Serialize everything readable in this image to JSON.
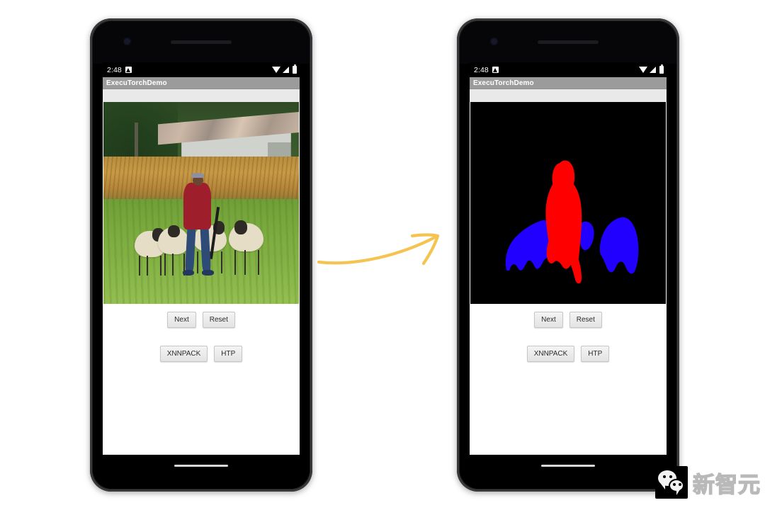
{
  "page": {
    "background_color": "#ffffff",
    "description": "ExecuTorchDemo Android app before and after semantic segmentation"
  },
  "arrow": {
    "name": "curved-arrow",
    "color": "#f5c34f"
  },
  "watermark": {
    "text": "新智元",
    "logo_name": "wechat-logo",
    "logo_bg": "#000000"
  },
  "phones": [
    {
      "id": "left",
      "statusbar": {
        "time": "2:48",
        "notification_icon": "notification-icon",
        "wifi_icon": "wifi-icon",
        "signal_icon": "cellular-signal-icon",
        "battery_icon": "battery-icon"
      },
      "appbar": {
        "title": "ExecuTorchDemo"
      },
      "image": {
        "kind": "photo",
        "alt": "Shepherd in red jacket with four sheep in a green field, barn and dry grass behind"
      },
      "controls": {
        "row1": [
          {
            "label": "Next"
          },
          {
            "label": "Reset"
          }
        ],
        "row2": [
          {
            "label": "XNNPACK"
          },
          {
            "label": "HTP"
          }
        ]
      },
      "navbar": {
        "home_indicator": "home-indicator"
      }
    },
    {
      "id": "right",
      "statusbar": {
        "time": "2:48",
        "notification_icon": "notification-icon",
        "wifi_icon": "wifi-icon",
        "signal_icon": "cellular-signal-icon",
        "battery_icon": "battery-icon"
      },
      "appbar": {
        "title": "ExecuTorchDemo"
      },
      "image": {
        "kind": "segmentation",
        "alt": "Segmentation mask: red person silhouette centered, blue sheep shapes on black background",
        "background_color": "#000000",
        "classes": [
          {
            "name": "person",
            "color": "#ff0000"
          },
          {
            "name": "sheep",
            "color": "#2200ff"
          },
          {
            "name": "background",
            "color": "#000000"
          }
        ]
      },
      "controls": {
        "row1": [
          {
            "label": "Next"
          },
          {
            "label": "Reset"
          }
        ],
        "row2": [
          {
            "label": "XNNPACK"
          },
          {
            "label": "HTP"
          }
        ]
      },
      "navbar": {
        "home_indicator": "home-indicator"
      }
    }
  ],
  "colors": {
    "appbar_bg": "#9b9b9b",
    "appbar_text": "#ffffff",
    "screen_bg": "#ffffff",
    "button_face": "#ededed",
    "phone_body": "#1d1d1f"
  }
}
